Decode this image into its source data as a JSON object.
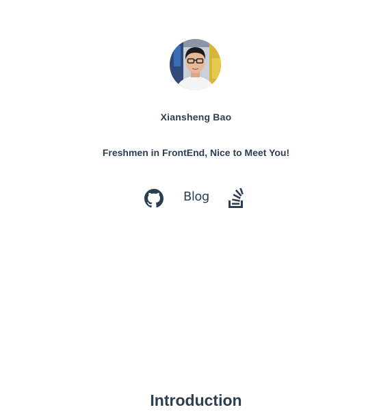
{
  "profile": {
    "name": "Xiansheng Bao",
    "tagline": "Freshmen in FrontEnd, Nice to Meet You!"
  },
  "social": {
    "github_icon": "github-icon",
    "blog_label": "Blog",
    "stackoverflow_icon": "stackoverflow-icon"
  },
  "sections": {
    "introduction_title": "Introduction"
  },
  "colors": {
    "text": "#2c3e50",
    "background": "#ffffff"
  }
}
